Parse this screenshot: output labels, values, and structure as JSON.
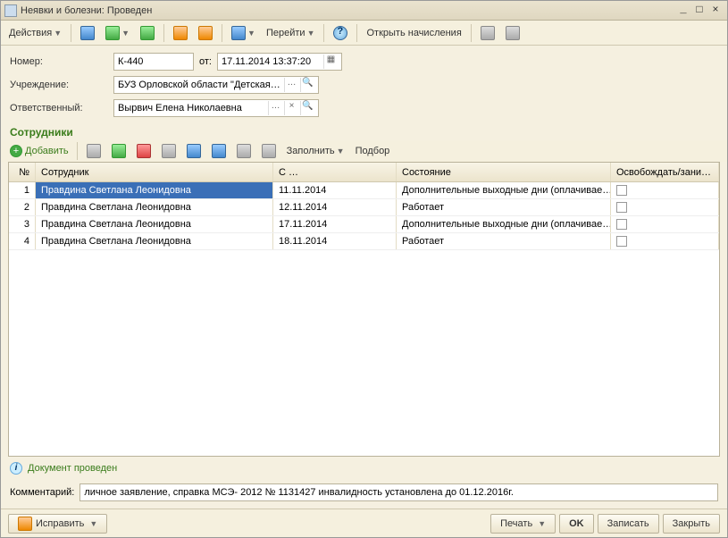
{
  "title": "Неявки и болезни: Проведен",
  "toolbar": {
    "actions": "Действия",
    "go": "Перейти",
    "open_calc": "Открыть начисления"
  },
  "form": {
    "number_label": "Номер:",
    "number": "К-440",
    "from_label": "от:",
    "date": "17.11.2014 13:37:20",
    "org_label": "Учреждение:",
    "org": "БУЗ Орловской области \"Детская г…",
    "resp_label": "Ответственный:",
    "resp": "Вырвич Елена Николаевна"
  },
  "section": "Сотрудники",
  "grid": {
    "toolbar": {
      "add": "Добавить",
      "fill": "Заполнить",
      "select": "Подбор"
    },
    "headers": {
      "num": "№",
      "emp": "Сотрудник",
      "date": "С …",
      "state": "Состояние",
      "release": "Освобождать/зани…"
    },
    "rows": [
      {
        "n": "1",
        "emp": "Правдина Светлана Леонидовна",
        "date": "11.11.2014",
        "state": "Дополнительные выходные дни (оплачивае…",
        "chk": false
      },
      {
        "n": "2",
        "emp": "Правдина Светлана Леонидовна",
        "date": "12.11.2014",
        "state": "Работает",
        "chk": false
      },
      {
        "n": "3",
        "emp": "Правдина Светлана Леонидовна",
        "date": "17.11.2014",
        "state": "Дополнительные выходные дни (оплачивае…",
        "chk": false
      },
      {
        "n": "4",
        "emp": "Правдина Светлана Леонидовна",
        "date": "18.11.2014",
        "state": "Работает",
        "chk": false
      }
    ]
  },
  "status": "Документ проведен",
  "comment_label": "Комментарий:",
  "comment": "личное заявление, справка МСЭ- 2012 № 1131427 инвалидность установлена до 01.12.2016г.",
  "bottom": {
    "fix": "Исправить",
    "print": "Печать",
    "ok": "OK",
    "write": "Записать",
    "close": "Закрыть"
  }
}
